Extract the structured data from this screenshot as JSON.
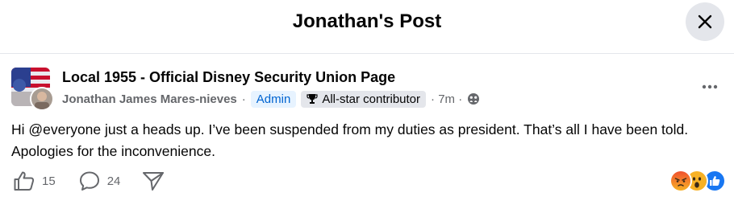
{
  "header": {
    "title": "Jonathan's Post"
  },
  "post": {
    "group_name": "Local 1955 - Official Disney Security Union Page",
    "author": "Jonathan James Mares-nieves",
    "separator": "·",
    "admin_badge": "Admin",
    "allstar_badge": "All-star contributor",
    "time": "· 7m ·",
    "text": "Hi @everyone just a heads up. I’ve been suspended from my duties as president. That’s all I have been told. Apologies for the inconvenience."
  },
  "actions": {
    "like_count": "15",
    "comment_count": "24"
  },
  "icons": {
    "close": "close-icon",
    "more": "more-icon",
    "like": "thumbs-up-icon",
    "comment": "comment-icon",
    "share": "share-icon",
    "trophy": "trophy-icon",
    "globe": "group-audience-icon"
  },
  "colors": {
    "admin_badge_bg": "#e7f3ff",
    "admin_badge_text": "#0064d1",
    "secondary_text": "#65676b",
    "like_blue": "#1877f2",
    "angry": "#e9710f",
    "wow": "#f7b125"
  }
}
